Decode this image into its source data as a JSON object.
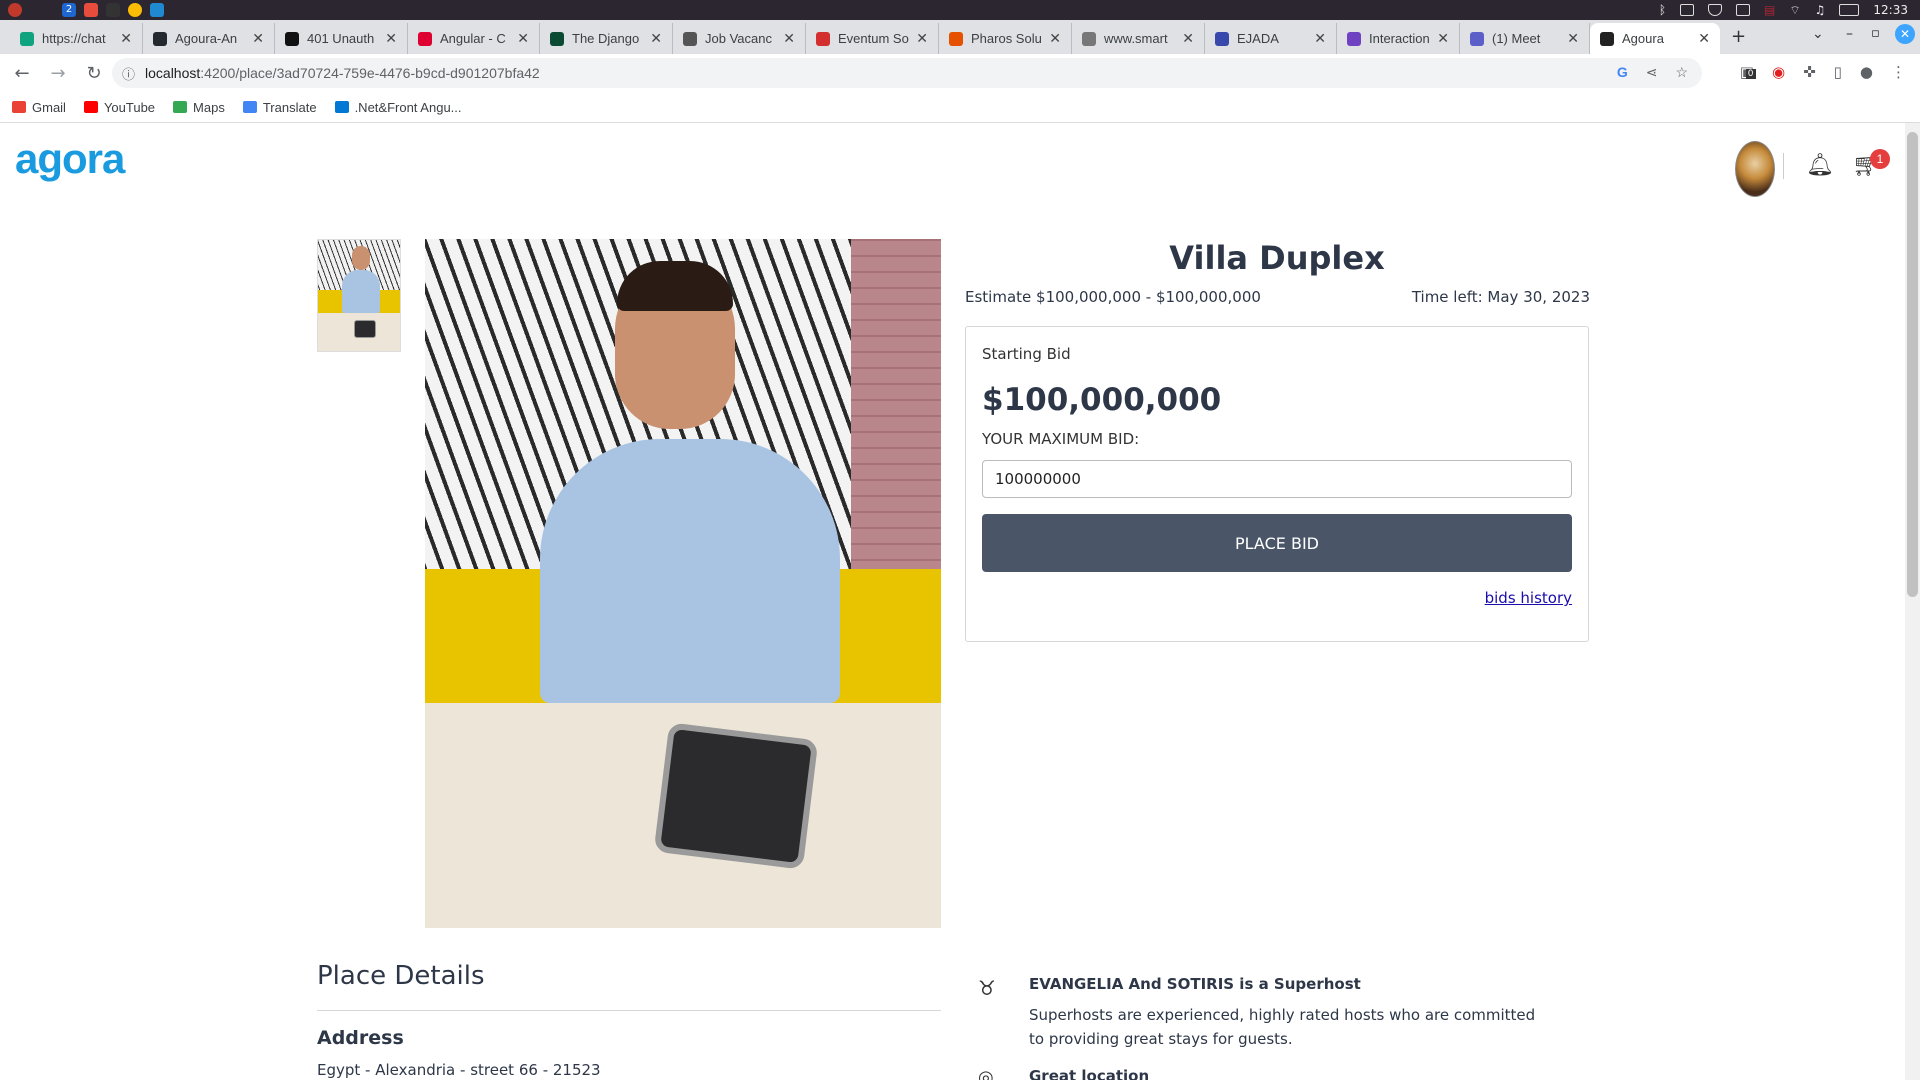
{
  "os": {
    "clock": "12:33",
    "workspace_num": "2"
  },
  "browser": {
    "tabs": [
      {
        "label": "https://chat",
        "color": "#10a37f"
      },
      {
        "label": "Agoura-An",
        "color": "#24292f"
      },
      {
        "label": "401 Unauth",
        "color": "#111111"
      },
      {
        "label": "Angular - C",
        "color": "#dd0031"
      },
      {
        "label": "The Django",
        "color": "#0c4b33"
      },
      {
        "label": "Job Vacanc",
        "color": "#555555"
      },
      {
        "label": "Eventum So",
        "color": "#d32f2f"
      },
      {
        "label": "Pharos Solu",
        "color": "#e65100"
      },
      {
        "label": "www.smart",
        "color": "#777777"
      },
      {
        "label": "EJADA",
        "color": "#3949ab"
      },
      {
        "label": "Interaction",
        "color": "#6f42c1"
      },
      {
        "label": "(1) Meet",
        "color": "#5b5fc7"
      },
      {
        "label": "Agoura",
        "color": "#222222"
      }
    ],
    "new_tab": "+",
    "url_host": "localhost",
    "url_path": ":4200/place/3ad70724-759e-4476-b9cd-d901207bfa42",
    "extension_badge": "0",
    "bookmarks": [
      {
        "label": "Gmail",
        "color": "#ea4335"
      },
      {
        "label": "YouTube",
        "color": "#ff0000"
      },
      {
        "label": "Maps",
        "color": "#34a853"
      },
      {
        "label": "Translate",
        "color": "#4285f4"
      },
      {
        "label": ".Net&Front Angu...",
        "color": "#0078d4"
      }
    ]
  },
  "header": {
    "logo": "agora",
    "cart_count": "1"
  },
  "listing": {
    "title": "Villa Duplex",
    "estimate": "Estimate $100,000,000 - $100,000,000",
    "time_left": "Time left: May 30, 2023",
    "starting_bid_label": "Starting Bid",
    "starting_bid": "$100,000,000",
    "max_bid_label": "YOUR MAXIMUM BID:",
    "max_bid_value": "100000000",
    "place_bid": "PLACE BID",
    "bids_history": "bids history"
  },
  "details": {
    "title": "Place Details",
    "address_label": "Address",
    "address": "Egypt - Alexandria - street 66 - 21523",
    "superhost_title": "EVANGELIA And SOTIRIS is a Superhost",
    "superhost_text": "Superhosts are experienced, highly rated hosts who are committed to providing great stays for guests.",
    "location_title": "Great location"
  }
}
